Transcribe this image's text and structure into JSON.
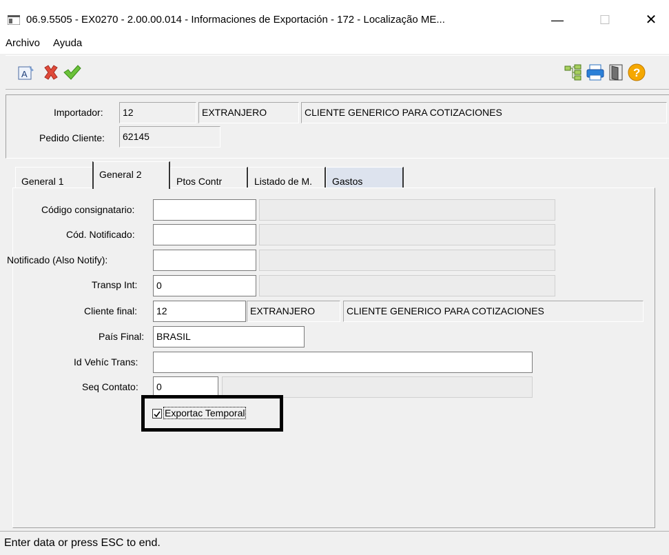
{
  "window": {
    "title": "06.9.5505 - EX0270 - 2.00.00.014 - Informaciones de Exportación - 172 - Localização ME...",
    "min_glyph": "—",
    "max_glyph": "☐",
    "close_glyph": "✕"
  },
  "menu": {
    "file": "Archivo",
    "help": "Ayuda"
  },
  "toolbar": {
    "icons": [
      "edit-text-icon",
      "cancel-icon",
      "confirm-icon",
      "tree-icon",
      "print-icon",
      "exit-door-icon",
      "help-icon"
    ]
  },
  "header": {
    "importer_label": "Importador:",
    "importer_code": "12",
    "importer_short": "EXTRANJERO",
    "importer_name": "CLIENTE GENERICO PARA COTIZACIONES",
    "order_label": "Pedido Cliente:",
    "order_value": "62145"
  },
  "tabs": [
    "General 1",
    "General 2",
    "Ptos Contr",
    "Listado de M.",
    "Gastos"
  ],
  "form": {
    "consignee_label": "Código consignatario:",
    "consignee_value": "",
    "notified_code_label": "Cód. Notificado:",
    "notified_code_value": "",
    "notified_label": "Notificado (Also Notify):",
    "notified_value": "",
    "transp_label": "Transp Int:",
    "transp_value": "0",
    "final_client_label": "Cliente final:",
    "final_client_code": "12",
    "final_client_short": "EXTRANJERO",
    "final_client_name": "CLIENTE GENERICO PARA COTIZACIONES",
    "final_country_label": "País Final:",
    "final_country_value": "BRASIL",
    "vehicle_label": "Id Vehíc Trans:",
    "vehicle_value": "",
    "seq_label": "Seq Contato:",
    "seq_value": "0",
    "temp_export_label": "Exportac Temporal",
    "temp_export_checked": true
  },
  "status": {
    "text": "Enter data or press ESC to end."
  }
}
